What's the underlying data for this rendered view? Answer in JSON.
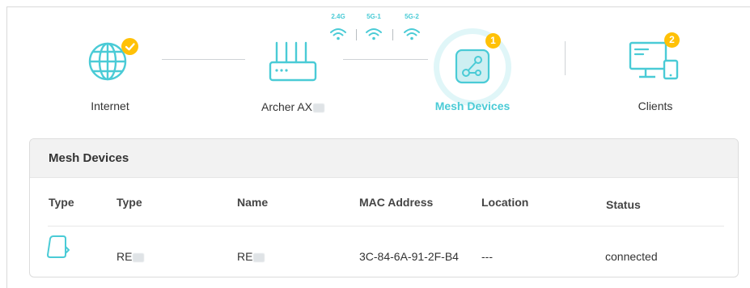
{
  "topology": {
    "internet": {
      "label": "Internet",
      "icon": "globe-icon",
      "status": "connected-check"
    },
    "router": {
      "label": "Archer AX"
    },
    "bands": [
      "2.4G",
      "5G-1",
      "5G-2"
    ],
    "mesh": {
      "label": "Mesh Devices",
      "count": "1",
      "icon": "mesh-network-icon"
    },
    "clients": {
      "label": "Clients",
      "count": "2",
      "icon": "clients-icon"
    }
  },
  "panel": {
    "title": "Mesh Devices",
    "columns": [
      "Type",
      "Type",
      "Name",
      "MAC Address",
      "Location",
      "Status"
    ],
    "rows": [
      {
        "icon": "range-extender-icon",
        "type": "RE",
        "name": "RE",
        "mac": "3C-84-6A-91-2F-B4",
        "location": "---",
        "status": "connected"
      }
    ]
  },
  "colors": {
    "accent": "#4acbd6",
    "badge": "#ffc107",
    "line": "#cfd3d6"
  }
}
